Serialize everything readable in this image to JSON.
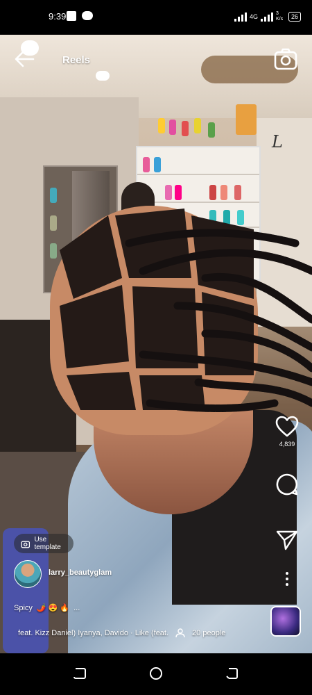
{
  "status_bar": {
    "time": "9:39",
    "network": "4G",
    "speed": "3 K/s",
    "battery": "26"
  },
  "header": {
    "title": "Reels",
    "back_icon": "arrow-left-icon",
    "camera_icon": "camera-icon"
  },
  "actions": {
    "like_count": "4,839",
    "comment_count": "",
    "icons": [
      "heart-icon",
      "comment-icon",
      "send-icon",
      "more-vertical-icon"
    ]
  },
  "reel": {
    "template_label": "Use template",
    "username": "larry_beautyglam",
    "caption": "Spicy",
    "caption_emojis": "🌶️ 😍 🔥",
    "caption_more": "...",
    "audio_text": "feat. Kizz Daniel)     Iyanya, Davido · Like (feat.",
    "people_count": "20 people"
  },
  "navbar": {
    "icons": [
      "recents-icon",
      "home-icon",
      "back-icon"
    ]
  }
}
